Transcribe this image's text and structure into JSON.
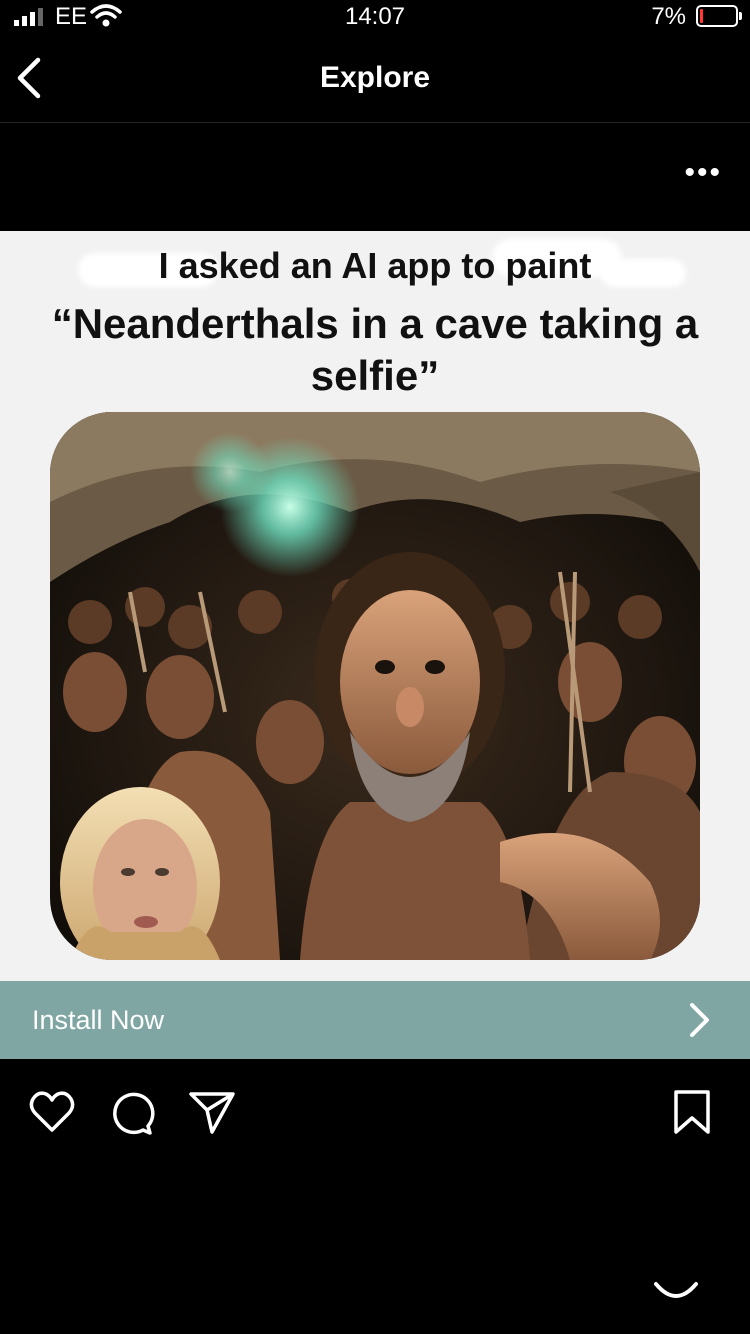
{
  "status_bar": {
    "carrier": "EE",
    "time": "14:07",
    "battery": "7%"
  },
  "nav": {
    "title": "Explore"
  },
  "post": {
    "caption_line1": "I asked an AI app to paint",
    "caption_line2": "“Neanderthals in a cave taking a selfie”",
    "image_description_icon": "cave-selfie-photo"
  },
  "cta": {
    "label": "Install Now"
  },
  "colors": {
    "cta_bg": "#7fa6a3",
    "background": "#000000",
    "battery_low": "#ff3b30"
  }
}
